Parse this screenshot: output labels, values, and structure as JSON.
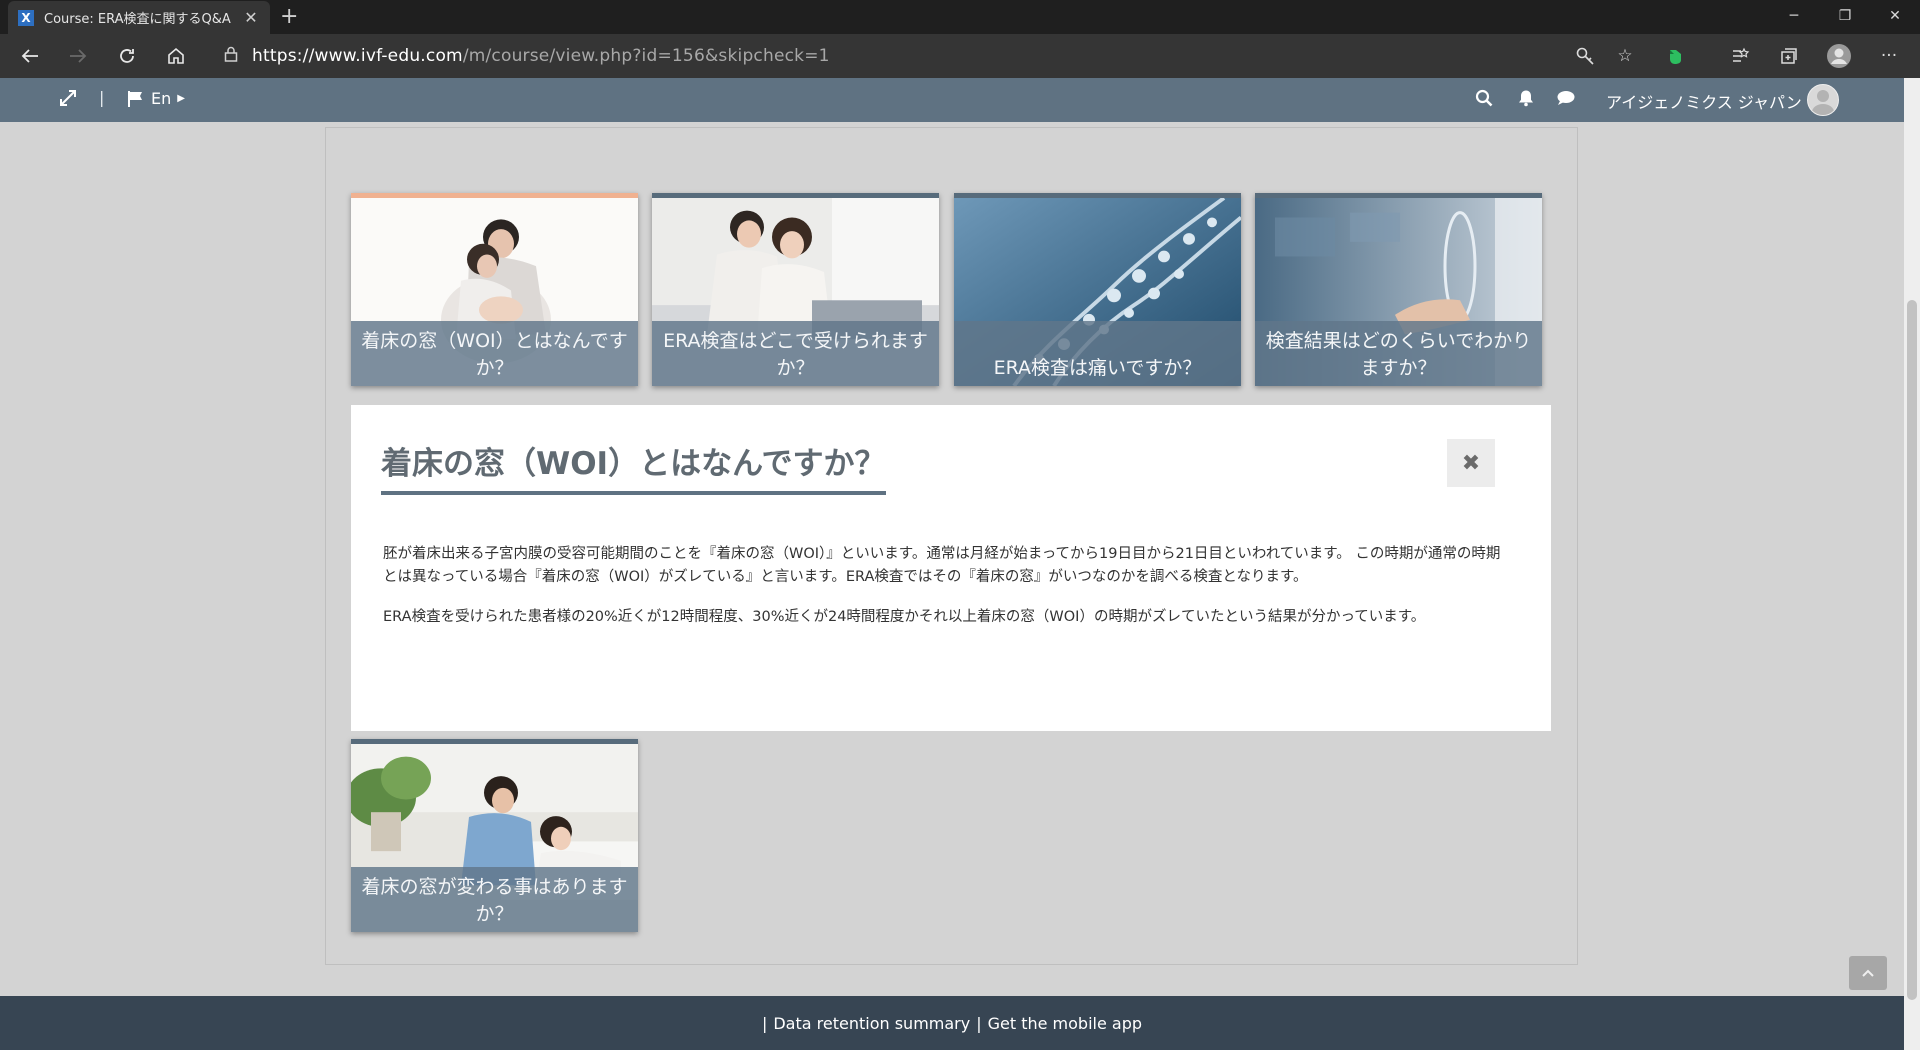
{
  "browser": {
    "tab_title": "Course: ERA検査に関するQ&A",
    "favicon": "X",
    "new_tab": "+",
    "url_prefix": "https://",
    "url_host": "www.ivf-edu.com",
    "url_path": "/m/course/view.php?id=156&skipcheck=1"
  },
  "navbar": {
    "language": "En",
    "user_name": "アイジェノミクス ジャパン",
    "separator": "|"
  },
  "tiles": [
    {
      "caption": "着床の窓（WOI）とはなんですか？",
      "active": true,
      "image": "couple-pregnancy-photo"
    },
    {
      "caption": "ERA検査はどこで受けられますか？",
      "active": false,
      "image": "couple-sofa-photo"
    },
    {
      "caption": "ERA検査は痛いですか？",
      "active": false,
      "image": "dna-helix-photo"
    },
    {
      "caption": "検査結果はどのくらいでわかりますか？",
      "active": false,
      "image": "dna-hand-photo"
    },
    {
      "caption": "着床の窓が変わる事はありますか？",
      "active": false,
      "image": "couple-bed-photo"
    }
  ],
  "panel": {
    "title": "着床の窓（WOI）とはなんですか？",
    "paragraphs": [
      "胚が着床出来る子宮内膜の受容可能期間のことを『着床の窓（WOI）』といいます。通常は月経が始まってから19日目から21日目といわれています。 この時期が通常の時期とは異なっている場合『着床の窓（WOI）がズレている』と言います。ERA検査ではその『着床の窓』がいつなのかを調べる検査となります。",
      "ERA検査を受けられた患者様の20%近くが12時間程度、30%近くが24時間程度かそれ以上着床の窓（WOI）の時期がズレていたという結果が分かっています。"
    ]
  },
  "footer": {
    "sep": "|",
    "link1": "Data retention summary",
    "link2": "Get the mobile app"
  },
  "colors": {
    "navbar": "#5f7282",
    "footer": "#374553",
    "active_tile_accent": "#f0b190",
    "tile_caption_bg": "#60768a"
  }
}
